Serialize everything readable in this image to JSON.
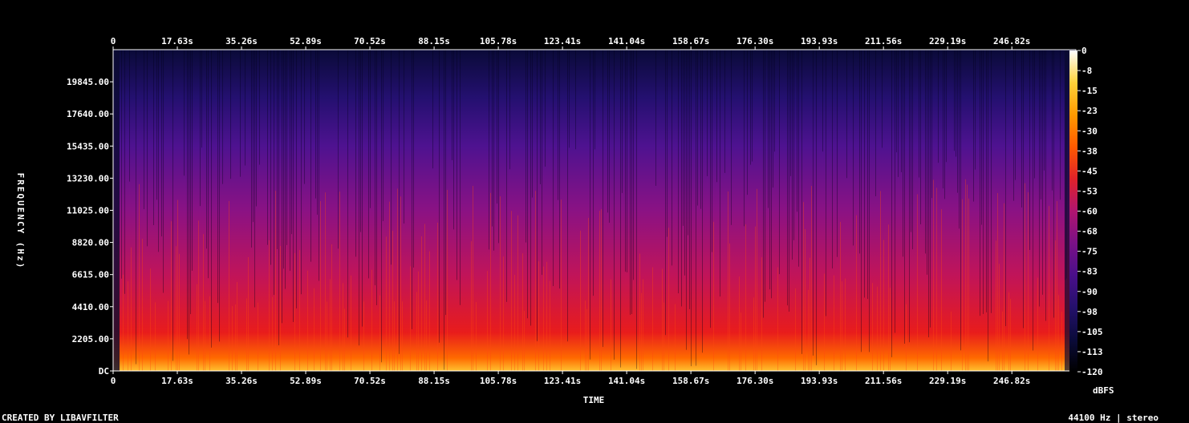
{
  "chart_data": {
    "type": "heatmap",
    "title": "",
    "xlabel": "TIME",
    "ylabel": "FREQUENCY (Hz)",
    "x_ticks": [
      "0",
      "17.63s",
      "35.26s",
      "52.89s",
      "70.52s",
      "88.15s",
      "105.78s",
      "123.41s",
      "141.04s",
      "158.67s",
      "176.30s",
      "193.93s",
      "211.56s",
      "229.19s",
      "246.82s"
    ],
    "x_tick_values": [
      0,
      17.63,
      35.26,
      52.89,
      70.52,
      88.15,
      105.78,
      123.41,
      141.04,
      158.67,
      176.3,
      193.93,
      211.56,
      229.19,
      246.82
    ],
    "xlim": [
      0,
      264.4
    ],
    "y_ticks": [
      "DC",
      "2205.00",
      "4410.00",
      "6615.00",
      "8820.00",
      "11025.00",
      "13230.00",
      "15435.00",
      "17640.00",
      "19845.00"
    ],
    "y_tick_values": [
      0,
      2205,
      4410,
      6615,
      8820,
      11025,
      13230,
      15435,
      17640,
      19845
    ],
    "ylim": [
      0,
      22050
    ],
    "colorbar": {
      "label": "dBFS",
      "ticks": [
        "0",
        "-8",
        "-15",
        "-23",
        "-30",
        "-38",
        "-45",
        "-53",
        "-60",
        "-68",
        "-75",
        "-83",
        "-90",
        "-98",
        "-105",
        "-113",
        "-120"
      ],
      "range": [
        -120,
        0
      ],
      "colors": [
        "#000000",
        "#0b0b3a",
        "#24106b",
        "#4a0f8a",
        "#7a1186",
        "#b01570",
        "#e0222a",
        "#ff5a00",
        "#ff9a00",
        "#ffd23a",
        "#ffffff"
      ]
    },
    "sample_rate_label": "44100 Hz | stereo",
    "creator_label": "CREATED BY LIBAVFILTER",
    "colors": {
      "background": "#000000",
      "text": "#ffffff"
    }
  }
}
